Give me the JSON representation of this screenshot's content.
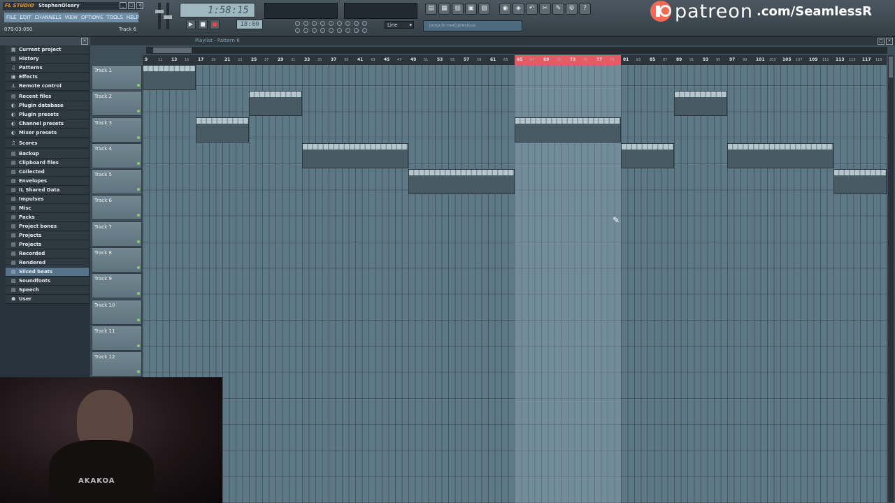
{
  "app": {
    "title": "StephenOleary",
    "logo_text": "FL STUDIO",
    "menu": [
      "FILE",
      "EDIT",
      "CHANNELS",
      "VIEW",
      "OPTIONS",
      "TOOLS",
      "HELP"
    ],
    "time_readout": "079:03:050",
    "current_track": "Track 6",
    "song_time": "1:58:15",
    "pattern_number": "18:00",
    "snap": "Line",
    "hint": "Jump to next/previous",
    "window_buttons": [
      "_",
      "□",
      "×"
    ]
  },
  "watermark": {
    "brand": "patreon",
    "url": ".com/SeamlessR"
  },
  "browser": {
    "items": [
      {
        "label": "Current project",
        "icon": "project-icon"
      },
      {
        "label": "History",
        "icon": "history-icon"
      },
      {
        "label": "Patterns",
        "icon": "note-icon"
      },
      {
        "label": "Effects",
        "icon": "effects-icon"
      },
      {
        "label": "Remote control",
        "icon": "remote-icon"
      },
      {
        "label": "Recent files",
        "icon": "folder-icon"
      },
      {
        "label": "Plugin database",
        "icon": "plugin-icon"
      },
      {
        "label": "Plugin presets",
        "icon": "plugin-icon"
      },
      {
        "label": "Channel presets",
        "icon": "plugin-icon"
      },
      {
        "label": "Mixer presets",
        "icon": "plugin-icon"
      },
      {
        "label": "Scores",
        "icon": "note-icon"
      },
      {
        "label": "Backup",
        "icon": "folder-icon"
      },
      {
        "label": "Clipboard files",
        "icon": "folder-icon"
      },
      {
        "label": "Collected",
        "icon": "folder-icon"
      },
      {
        "label": "Envelopes",
        "icon": "folder-icon"
      },
      {
        "label": "IL Shared Data",
        "icon": "folder-icon"
      },
      {
        "label": "Impulses",
        "icon": "folder-icon"
      },
      {
        "label": "Misc",
        "icon": "folder-icon"
      },
      {
        "label": "Packs",
        "icon": "folder-icon"
      },
      {
        "label": "Project bones",
        "icon": "folder-icon"
      },
      {
        "label": "Projects",
        "icon": "folder-icon"
      },
      {
        "label": "Projects",
        "icon": "folder-icon"
      },
      {
        "label": "Recorded",
        "icon": "folder-icon"
      },
      {
        "label": "Rendered",
        "icon": "folder-icon"
      },
      {
        "label": "Sliced beats",
        "icon": "folder-icon",
        "selected": true
      },
      {
        "label": "Soundfonts",
        "icon": "folder-icon"
      },
      {
        "label": "Speech",
        "icon": "folder-icon"
      },
      {
        "label": "User",
        "icon": "user-icon"
      }
    ]
  },
  "playlist": {
    "title": "Playlist - Pattern 6",
    "ruler": [
      "9",
      "13",
      "17",
      "21",
      "25",
      "29",
      "33",
      "37",
      "41",
      "45",
      "49",
      "53",
      "57",
      "61",
      "65",
      "69",
      "73",
      "77",
      "81",
      "85",
      "89",
      "93",
      "97",
      "101",
      "105",
      "109",
      "113",
      "117"
    ],
    "ruler_minor": [
      "11",
      "15",
      "19",
      "23",
      "27",
      "31",
      "35",
      "39",
      "43",
      "47",
      "51",
      "55",
      "59",
      "63",
      "67",
      "71",
      "75",
      "79",
      "83",
      "87",
      "91",
      "95",
      "99",
      "103",
      "107",
      "111",
      "115",
      "119"
    ],
    "tracks": [
      "Track 1",
      "Track 2",
      "Track 3",
      "Track 4",
      "Track 5",
      "Track 6",
      "Track 7",
      "Track 8",
      "Track 9",
      "Track 10",
      "Track 11",
      "Track 12"
    ],
    "clips": [
      {
        "track": 0,
        "start": 9,
        "length": 8
      },
      {
        "track": 1,
        "start": 25,
        "length": 8
      },
      {
        "track": 1,
        "start": 89,
        "length": 8
      },
      {
        "track": 2,
        "start": 17,
        "length": 8
      },
      {
        "track": 2,
        "start": 65,
        "length": 16
      },
      {
        "track": 3,
        "start": 33,
        "length": 16
      },
      {
        "track": 3,
        "start": 81,
        "length": 8
      },
      {
        "track": 3,
        "start": 97,
        "length": 16
      },
      {
        "track": 4,
        "start": 49,
        "length": 16
      },
      {
        "track": 4,
        "start": 113,
        "length": 8
      }
    ],
    "selection": {
      "start": 65,
      "end": 81
    }
  },
  "webcam": {
    "caption": "AKAKOA"
  }
}
